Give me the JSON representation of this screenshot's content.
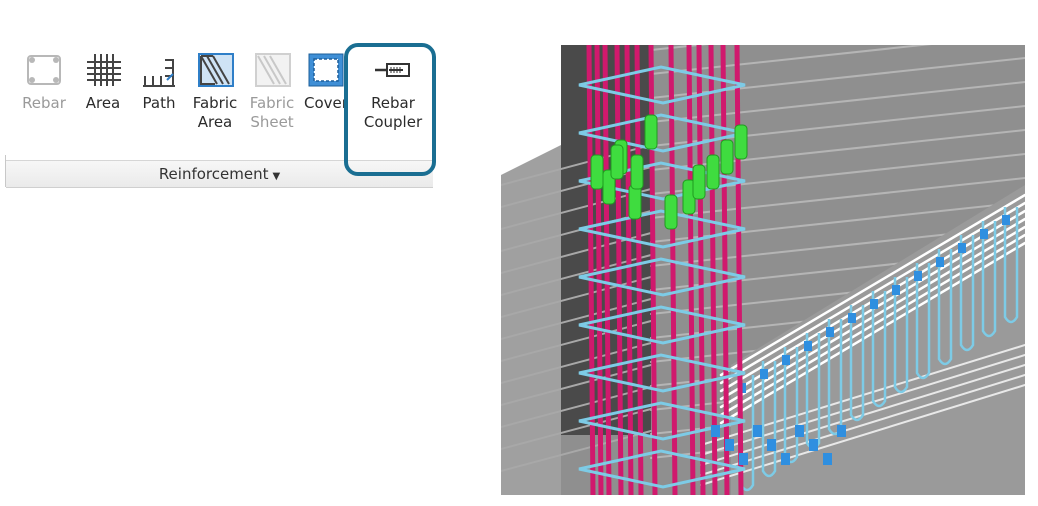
{
  "ribbon": {
    "panel_title": "Reinforcement",
    "tools": [
      {
        "label_lines": [
          "Rebar"
        ],
        "icon": "rebar-icon",
        "enabled": false
      },
      {
        "label_lines": [
          "Area"
        ],
        "icon": "area-reinforcement-icon",
        "enabled": true
      },
      {
        "label_lines": [
          "Path"
        ],
        "icon": "path-reinforcement-icon",
        "enabled": true
      },
      {
        "label_lines": [
          "Fabric",
          "Area"
        ],
        "icon": "fabric-area-icon",
        "enabled": true
      },
      {
        "label_lines": [
          "Fabric",
          "Sheet"
        ],
        "icon": "fabric-sheet-icon",
        "enabled": false
      },
      {
        "label_lines": [
          "Cover"
        ],
        "icon": "cover-icon",
        "enabled": true
      },
      {
        "label_lines": [
          "Rebar",
          "Coupler"
        ],
        "icon": "rebar-coupler-icon",
        "enabled": true
      }
    ],
    "highlighted_tool": "Rebar Coupler"
  },
  "view": {
    "colors": {
      "column_bars": "#d0196d",
      "ties": "#7dcbe6",
      "couplers": "#3fdc3f",
      "beam_stirrups": "#2f8fe0",
      "longitudinal_bars": "#ffffff",
      "concrete": "#8f8f8f",
      "concrete_dark": "#4a4a4a"
    }
  },
  "colors": {
    "highlight": "#1a6e92",
    "icon_blue": "#2f7fc8"
  }
}
